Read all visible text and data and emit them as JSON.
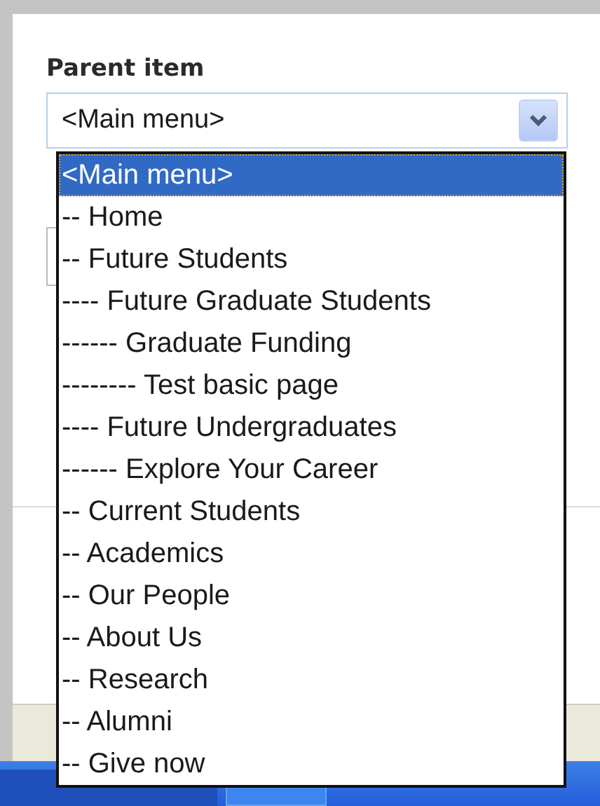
{
  "form": {
    "label": "Parent item",
    "select": {
      "value": "<Main menu>",
      "options": [
        {
          "label": "<Main menu>",
          "selected": true
        },
        {
          "label": "-- Home",
          "selected": false
        },
        {
          "label": "-- Future Students",
          "selected": false
        },
        {
          "label": "---- Future Graduate Students",
          "selected": false
        },
        {
          "label": "------ Graduate Funding",
          "selected": false
        },
        {
          "label": "-------- Test basic page",
          "selected": false
        },
        {
          "label": "---- Future Undergraduates",
          "selected": false
        },
        {
          "label": "------ Explore Your Career",
          "selected": false
        },
        {
          "label": "-- Current Students",
          "selected": false
        },
        {
          "label": "-- Academics",
          "selected": false
        },
        {
          "label": "-- Our People",
          "selected": false
        },
        {
          "label": "-- About Us",
          "selected": false
        },
        {
          "label": "-- Research",
          "selected": false
        },
        {
          "label": "-- Alumni",
          "selected": false
        },
        {
          "label": "-- Give now",
          "selected": false
        }
      ]
    }
  }
}
